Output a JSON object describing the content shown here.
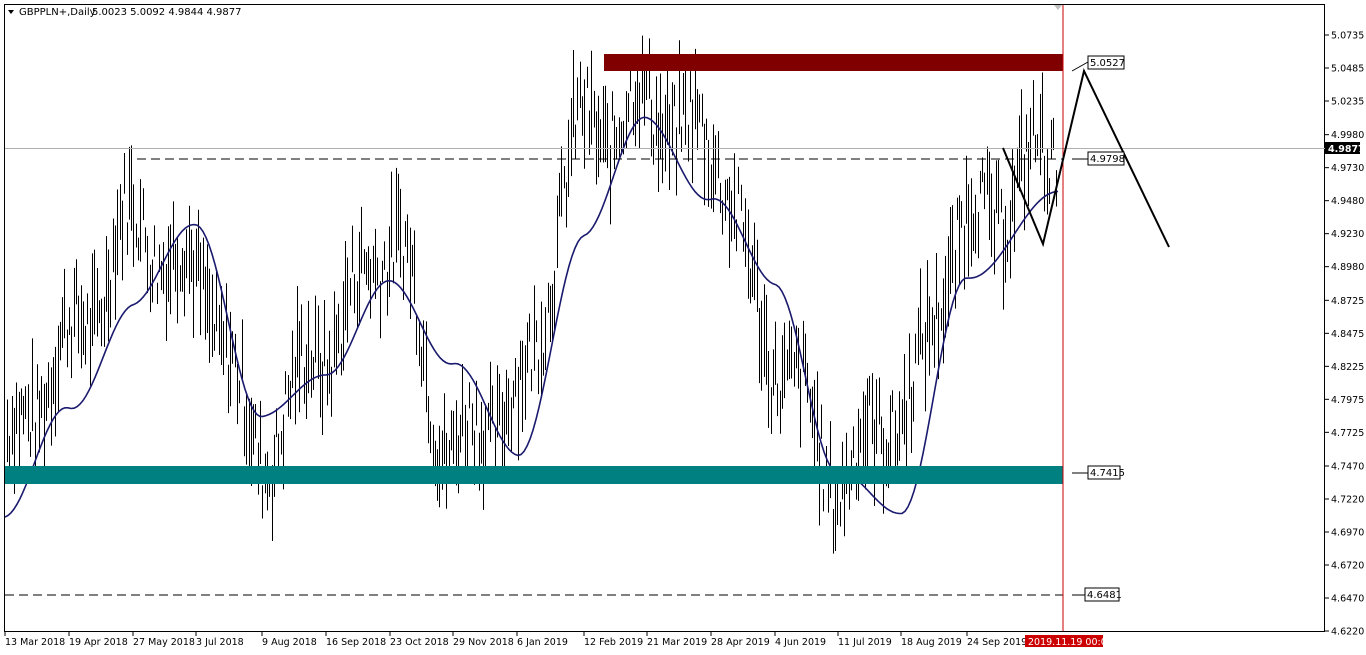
{
  "chart_data": {
    "type": "line",
    "header": {
      "symbol": "GBPPLN+,Daily",
      "ohlc": "5.0023 5.0092 4.9844 4.9877"
    },
    "ylim": [
      4.622,
      5.083
    ],
    "y_ticks": [
      "5.0735",
      "5.0485",
      "5.0235",
      "4.9980",
      "4.9730",
      "4.9480",
      "4.9230",
      "4.8980",
      "4.8725",
      "4.8475",
      "4.8225",
      "4.7975",
      "4.7725",
      "4.7470",
      "4.7220",
      "4.6970",
      "4.6720",
      "4.6470",
      "4.6220"
    ],
    "x_ticks": [
      "13 Mar 2018",
      "19 Apr 2018",
      "27 May 2018",
      "3 Jul 2018",
      "9 Aug 2018",
      "16 Sep 2018",
      "23 Oct 2018",
      "29 Nov 2018",
      "6 Jan 2019",
      "12 Feb 2019",
      "21 Mar 2019",
      "28 Apr 2019",
      "4 Jun 2019",
      "11 Jul 2019",
      "18 Aug 2019",
      "24 Sep 2019"
    ],
    "current_time_label": "2019.11.19 00:00",
    "current_price_label": "4.9877",
    "current_price": 4.9877,
    "levels": [
      {
        "label": "5.0527",
        "value": 5.0527,
        "kind": "resistance-zone",
        "color": "#800000"
      },
      {
        "label": "4.9798",
        "value": 4.9798,
        "kind": "dashed"
      },
      {
        "label": "4.7415",
        "value": 4.7415,
        "kind": "support-zone",
        "color": "#008080"
      },
      {
        "label": "4.6481",
        "value": 4.6481,
        "kind": "dashed"
      }
    ],
    "moving_average": [
      [
        "13 Mar 2018",
        4.707
      ],
      [
        "19 Apr 2018",
        4.79
      ],
      [
        "27 May 2018",
        4.872
      ],
      [
        "3 Jul 2018",
        4.925
      ],
      [
        "9 Aug 2018",
        4.79
      ],
      [
        "16 Sep 2018",
        4.81
      ],
      [
        "23 Oct 2018",
        4.893
      ],
      [
        "29 Nov 2018",
        4.82
      ],
      [
        "6 Jan 2019",
        4.758
      ],
      [
        "12 Feb 2019",
        4.92
      ],
      [
        "21 Mar 2019",
        5.01
      ],
      [
        "28 Apr 2019",
        4.952
      ],
      [
        "4 Jun 2019",
        4.88
      ],
      [
        "11 Jul 2019",
        4.748
      ],
      [
        "18 Aug 2019",
        4.705
      ],
      [
        "24 Sep 2019",
        4.895
      ],
      [
        "2019.11.19 00:00",
        4.95
      ]
    ],
    "price_path": [
      [
        "13 Mar 2018",
        4.76
      ],
      [
        "19 Apr 2018",
        4.84
      ],
      [
        "27 May 2018",
        4.93
      ],
      [
        "3 Jul 2018",
        4.89
      ],
      [
        "9 Aug 2018",
        4.76
      ],
      [
        "16 Sep 2018",
        4.84
      ],
      [
        "23 Oct 2018",
        4.92
      ],
      [
        "29 Nov 2018",
        4.76
      ],
      [
        "6 Jan 2019",
        4.8
      ],
      [
        "12 Feb 2019",
        5.0
      ],
      [
        "21 Mar 2019",
        5.02
      ],
      [
        "28 Apr 2019",
        4.99
      ],
      [
        "4 Jun 2019",
        4.83
      ],
      [
        "11 Jul 2019",
        4.74
      ],
      [
        "18 Aug 2019",
        4.79
      ],
      [
        "24 Sep 2019",
        4.93
      ],
      [
        "2019.11.19 00:00",
        4.988
      ]
    ],
    "price_extremes": {
      "high": 5.073,
      "low": 4.636
    },
    "colors": {
      "ma": "#1a1a6e",
      "bars": "#000000",
      "grid_dash": "#000000",
      "vline": "#cc0000",
      "time_label_bg": "#cc0000"
    }
  }
}
